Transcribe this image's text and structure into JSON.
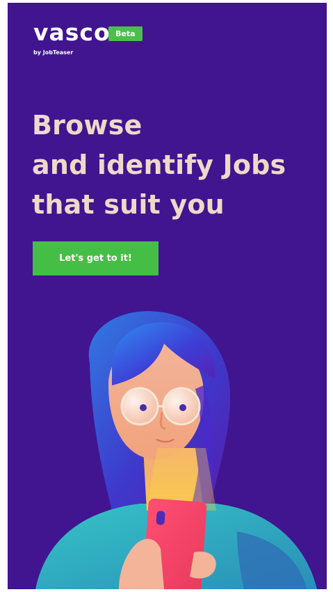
{
  "brand": {
    "name": "vasco",
    "badge": "Beta",
    "byline": "by JobTeaser"
  },
  "hero": {
    "headline_lines": [
      "Browse",
      "and identify Jobs",
      "that suit you"
    ]
  },
  "cta": {
    "label": "Let's get to it!"
  },
  "colors": {
    "background": "#41158f",
    "headline": "#eed9c9",
    "accent_green": "#45be45",
    "white": "#ffffff"
  },
  "illustration": {
    "subject": "person-looking-at-phone"
  }
}
